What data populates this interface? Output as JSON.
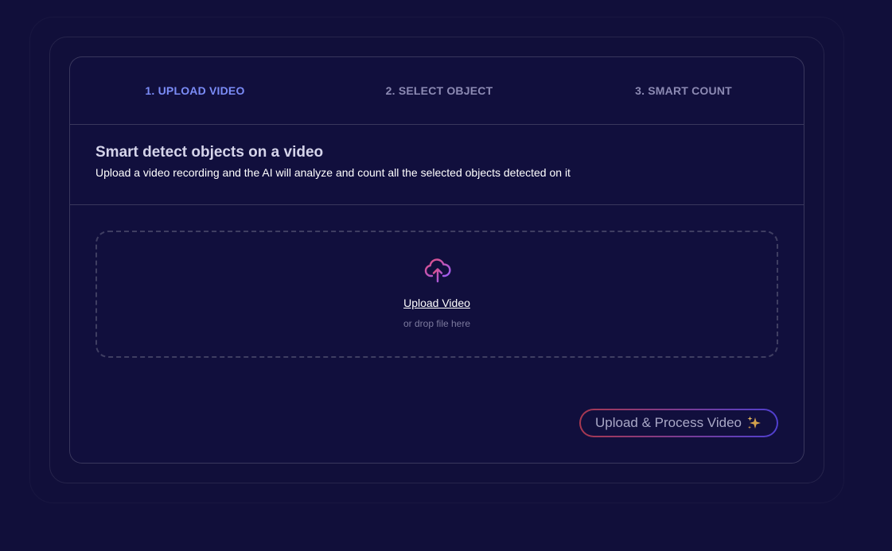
{
  "steps": [
    {
      "label": "1. UPLOAD VIDEO",
      "active": true
    },
    {
      "label": "2. SELECT OBJECT",
      "active": false
    },
    {
      "label": "3. SMART COUNT",
      "active": false
    }
  ],
  "intro": {
    "title": "Smart detect objects on a video",
    "description": "Upload a video recording and the AI will analyze and count all the selected objects detected on it"
  },
  "dropzone": {
    "icon": "cloud-upload-icon",
    "link_label": "Upload Video",
    "hint": "or drop file here"
  },
  "actions": {
    "process_label": "Upload & Process Video",
    "process_icon": "sparkle-icon"
  },
  "colors": {
    "background": "#110f3a",
    "active_step": "#7b8cf7",
    "inactive_step": "#8c8ab3",
    "gradient_start": "#a8384f",
    "gradient_end": "#4f3fd0",
    "icon_gradient_start": "#e34f7d",
    "icon_gradient_end": "#9b5cf5"
  }
}
